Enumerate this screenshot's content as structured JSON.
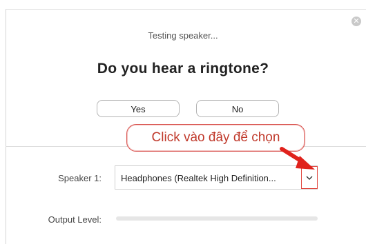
{
  "dialog": {
    "testing_text": "Testing speaker...",
    "question": "Do you hear a ringtone?",
    "yes_label": "Yes",
    "no_label": "No"
  },
  "annotation": {
    "callout_text": "Click vào đây để chọn",
    "color": "#e0463e"
  },
  "speaker": {
    "label": "Speaker 1:",
    "selected": "Headphones (Realtek High Definition..."
  },
  "output": {
    "label": "Output Level:",
    "level_percent": 0
  },
  "icons": {
    "close": "close-icon",
    "dropdown": "chevron-down-icon"
  }
}
